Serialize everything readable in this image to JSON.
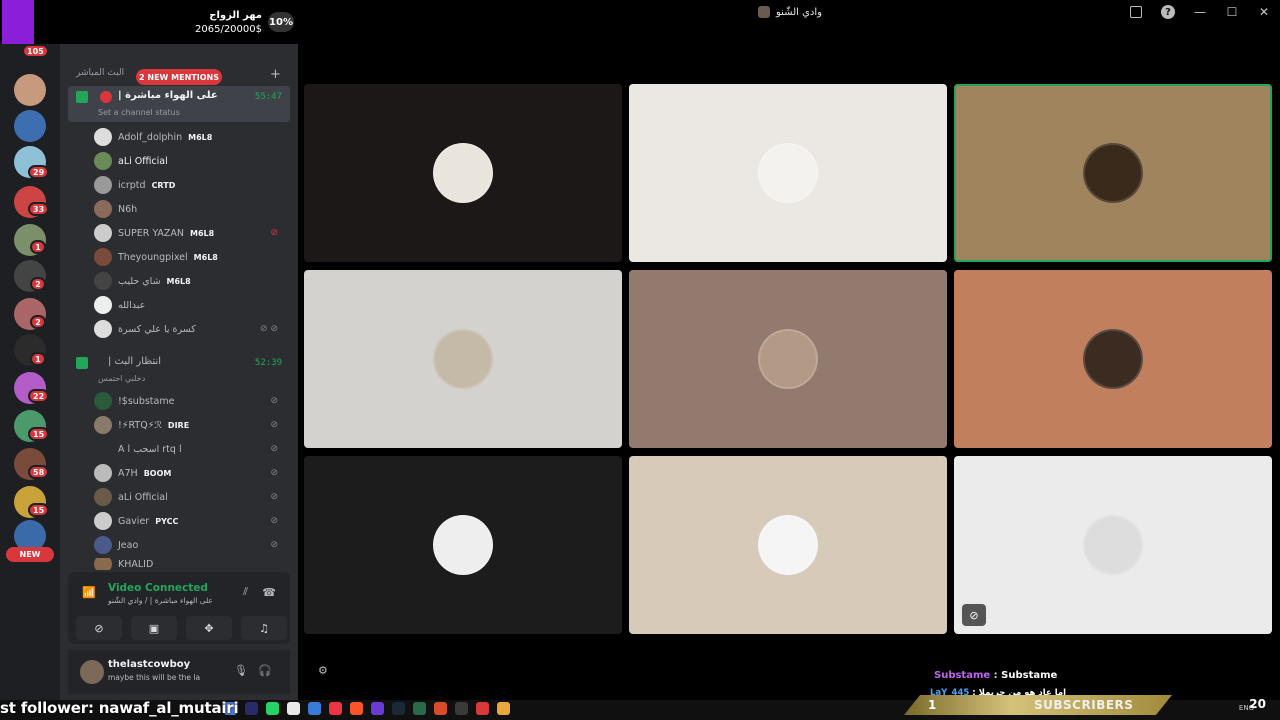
{
  "window": {
    "title": "وادي الشّنو",
    "icons": [
      "screen-share-icon",
      "help-icon",
      "minimize-icon",
      "maximize-icon",
      "close-icon"
    ]
  },
  "goal": {
    "title": "مهر الزواج",
    "amount": "2065/20000$",
    "percent": "10%",
    "progress": 0.1,
    "bar_color": "#8b1ed8"
  },
  "servers": {
    "badges": [
      "105",
      "29",
      "33",
      "1",
      "2",
      "2",
      "1",
      "22",
      "15",
      "58",
      "15"
    ],
    "new_label": "NEW"
  },
  "sidebar": {
    "category": "البث المباشر",
    "mentions": "2 NEW MENTIONS",
    "channels": [
      {
        "name": "على الهواء مباشرة |",
        "time": "55:47",
        "status": "Set a channel status",
        "members": [
          {
            "name": "Adolf_dolphin",
            "tag": "M6L8"
          },
          {
            "name": "aLi Official",
            "tag": ""
          },
          {
            "name": "icrptd",
            "tag": "CRTD"
          },
          {
            "name": "N6h",
            "tag": ""
          },
          {
            "name": "SUPER YAZAN",
            "tag": "M6L8"
          },
          {
            "name": "Theyoungpixel",
            "tag": "M6L8"
          },
          {
            "name": "شاي حليب",
            "tag": "M6L8"
          },
          {
            "name": "عبدالله",
            "tag": ""
          },
          {
            "name": "كسرة يا علي كسرة",
            "tag": ""
          }
        ]
      },
      {
        "name": "انتظار البث |",
        "time": "52:39",
        "status": "دخلني احتمس",
        "members": [
          {
            "name": "!$substame",
            "tag": ""
          },
          {
            "name": "!⚡RTQ⚡ℛ",
            "tag": "DIRE"
          },
          {
            "name": "A l اسحب rtq l",
            "tag": ""
          },
          {
            "name": "A7H",
            "tag": "BOOM"
          },
          {
            "name": "aLi Official",
            "tag": ""
          },
          {
            "name": "Gavier",
            "tag": "PYCC"
          },
          {
            "name": "Jeao",
            "tag": ""
          },
          {
            "name": "KHALID",
            "tag": ""
          }
        ]
      }
    ]
  },
  "voice_panel": {
    "status": "Video Connected",
    "channel": "على الهواء مباشرة | / وادي الشّنو"
  },
  "user_panel": {
    "username": "thelastcowboy",
    "status": "maybe this will be the la"
  },
  "video_tiles": [
    {
      "bg": "#1c1817",
      "avatar": "#e9e4dc"
    },
    {
      "bg": "#ebe8e4",
      "avatar": "#f4f2ef"
    },
    {
      "bg": "#a0845e",
      "avatar": "#3a2a1c",
      "speaking": true
    },
    {
      "bg": "#d3d2cf",
      "avatar": "#c5b9a8"
    },
    {
      "bg": "#927a6e",
      "avatar": "#b39a86"
    },
    {
      "bg": "#c17f5d",
      "avatar": "#3b2b20"
    },
    {
      "bg": "#1c1c1c",
      "avatar": "#eeeeee"
    },
    {
      "bg": "#d8cab9",
      "avatar": "#f5f5f5"
    },
    {
      "bg": "#ebebeb",
      "avatar": "#dddddd",
      "camera_off": true
    }
  ],
  "chat": [
    {
      "user": "Substame",
      "message": "Substame"
    },
    {
      "user": "LaY_445",
      "message": "اما عاد هو من حريملا"
    }
  ],
  "stream_overlay": {
    "follower_text": "st follower: nawaf_al_mutairi",
    "subscribers_count": "1",
    "subscribers_label": "SUBSCRIBERS",
    "tray_lang": "ENG",
    "tray_number": "20"
  }
}
